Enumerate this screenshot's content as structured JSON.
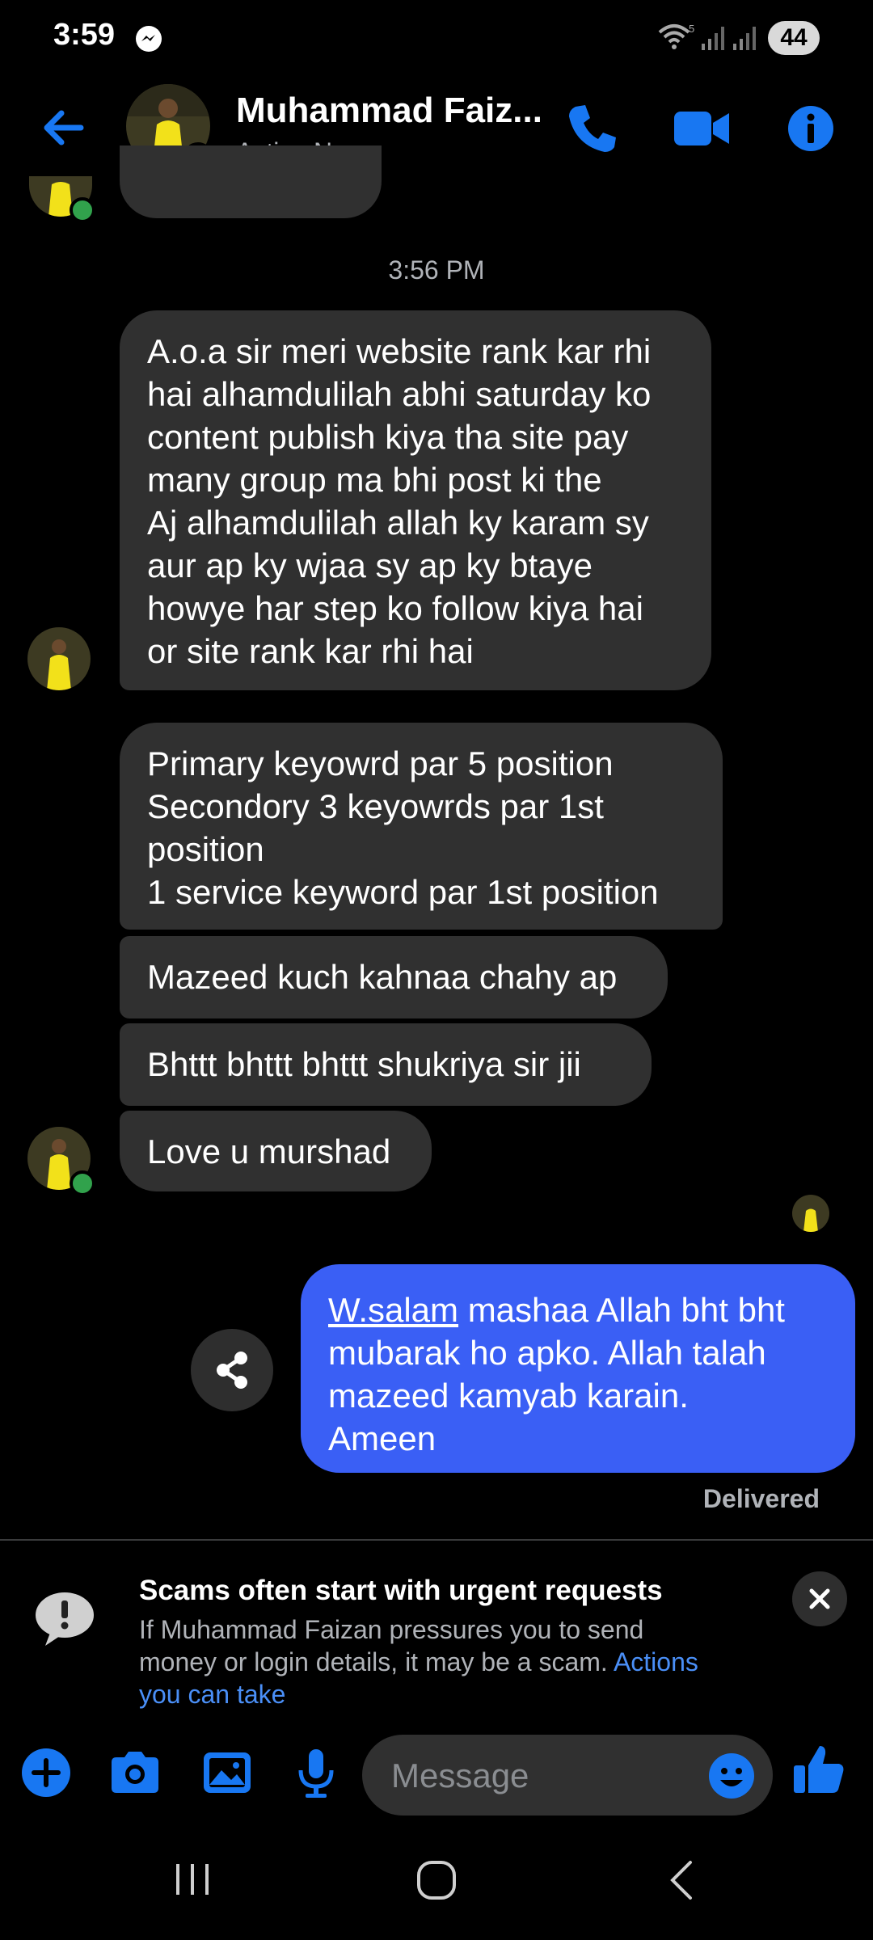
{
  "status_bar": {
    "time": "3:59",
    "battery": "44",
    "wifi_badge": "5"
  },
  "header": {
    "contact_name": "Muhammad Faiz...",
    "status": "Active Now"
  },
  "chat": {
    "timestamp": "3:56 PM",
    "incoming": [
      {
        "lines": [
          "A.o.a sir meri website rank kar rhi",
          "hai alhamdulilah abhi saturday ko",
          "content publish kiya tha site pay",
          "many group ma bhi post ki the",
          "Aj alhamdulilah allah ky karam sy",
          "aur ap ky wjaa sy ap ky btaye",
          "howye har step ko follow kiya hai",
          "or site rank kar rhi hai"
        ]
      },
      {
        "lines": [
          "Primary keyowrd par 5 position",
          "Secondory 3 keyowrds par 1st",
          "position",
          "1 service keyword par 1st position"
        ]
      },
      {
        "lines": [
          "Mazeed kuch kahnaa chahy ap"
        ]
      },
      {
        "lines": [
          "Bhttt bhttt bhttt shukriya sir jii"
        ]
      },
      {
        "lines": [
          "Love u murshad"
        ]
      }
    ],
    "outgoing": {
      "underlined": "W.salam",
      "rest_first_line": " mashaa Allah bht bht",
      "lines": [
        "mubarak ho apko. Allah talah",
        "mazeed kamyab karain.",
        "Ameen"
      ]
    },
    "delivery_status": "Delivered"
  },
  "scam_notice": {
    "title": "Scams often start with urgent requests",
    "body": "If Muhammad Faizan pressures you to send money or login details, it may be a scam.",
    "link": "Actions you can take"
  },
  "composer": {
    "placeholder": "Message"
  },
  "icons": [
    "back-arrow-icon",
    "phone-icon",
    "video-camera-icon",
    "info-icon",
    "share-icon",
    "exclamation-bubble-icon",
    "close-icon",
    "plus-icon",
    "camera-icon",
    "gallery-icon",
    "microphone-icon",
    "emoji-icon",
    "thumbs-up-icon",
    "recents-icon",
    "home-icon",
    "back-nav-icon"
  ],
  "colors": {
    "accent": "#3a5ff5",
    "icon_blue": "#1877f2",
    "bubble_in": "#303030",
    "online": "#31a24c",
    "link": "#4a8ff7"
  }
}
